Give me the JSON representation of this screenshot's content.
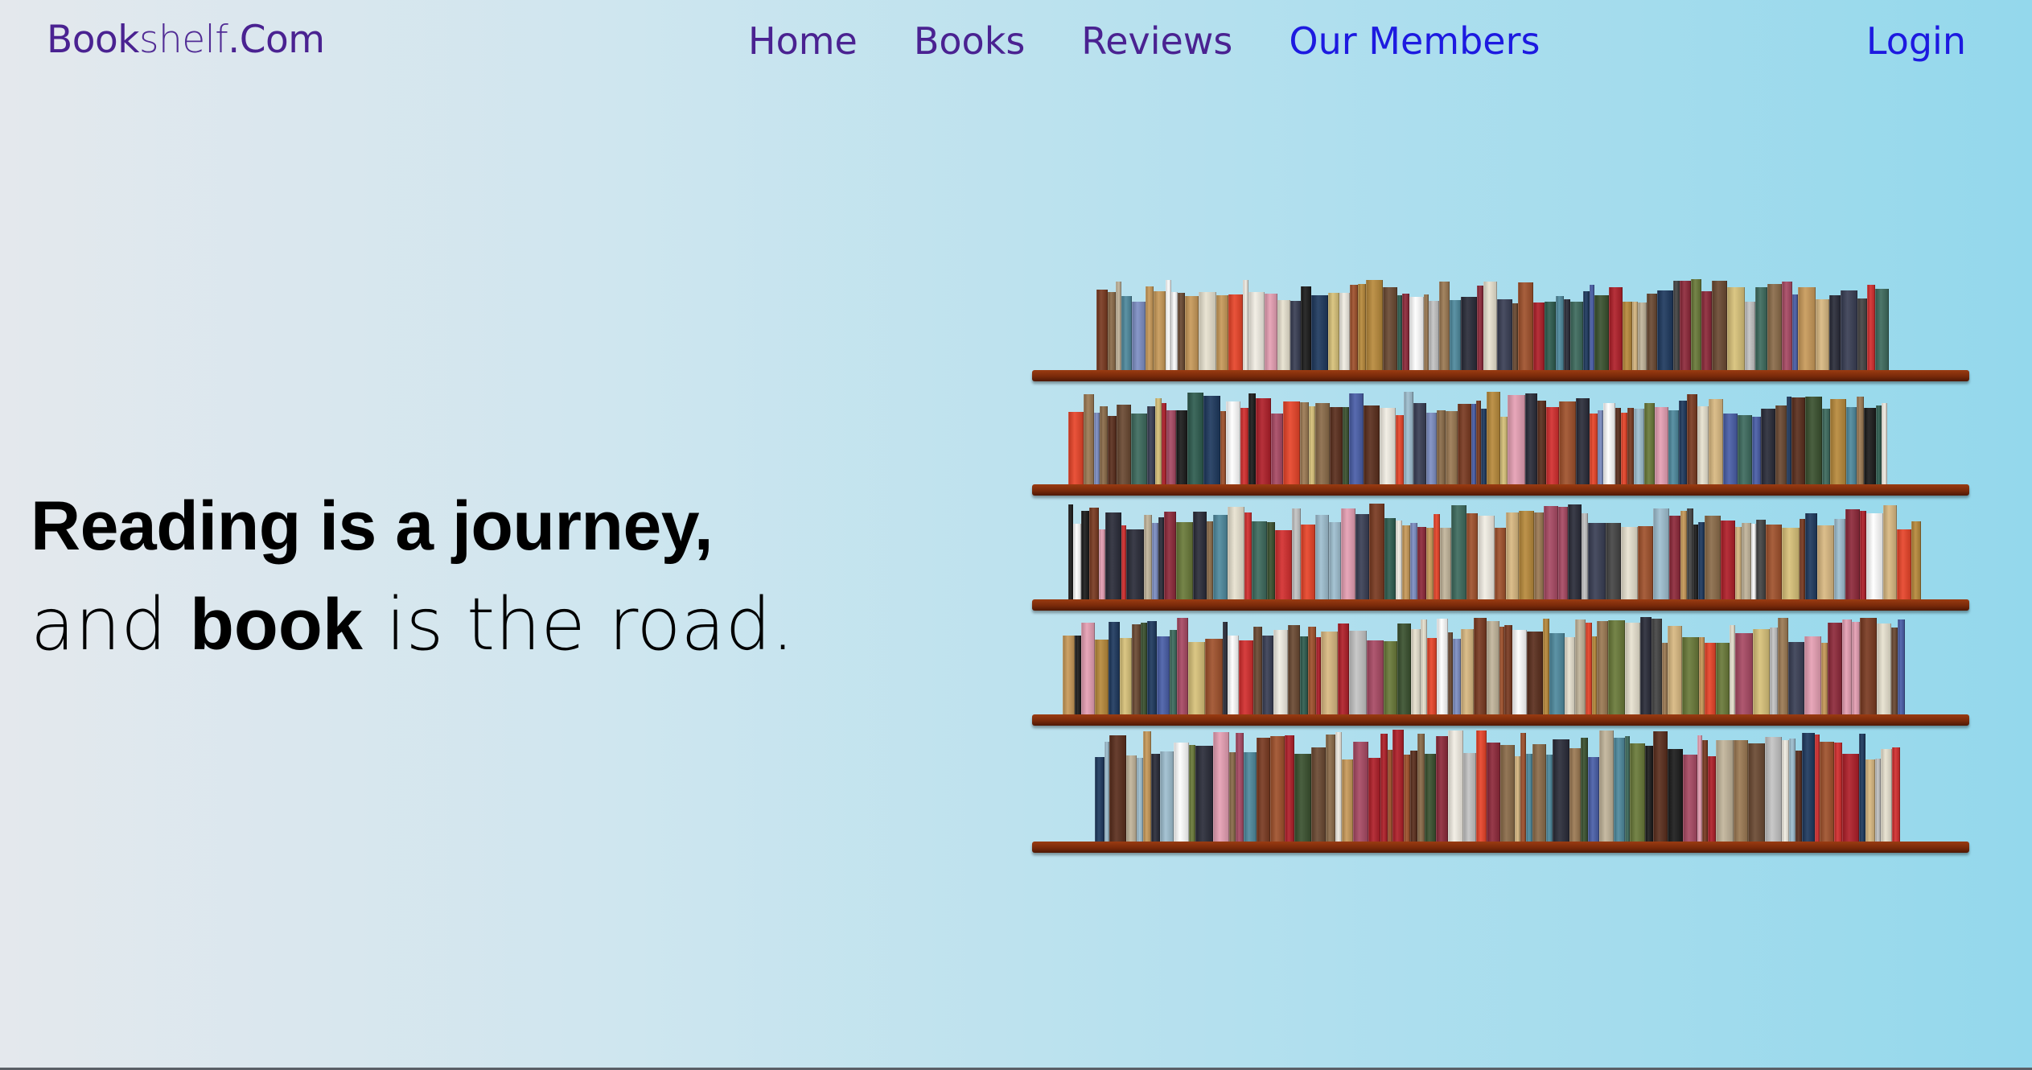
{
  "navbar": {
    "logo_part1": "Book",
    "logo_part2": "shelf",
    "logo_part3": ".Com",
    "links": [
      "Home",
      "Books",
      "Reviews",
      "Our Members"
    ],
    "active_link": "Our Members",
    "login_label": "Login"
  },
  "hero": {
    "line1": "Reading is a journey,",
    "line2_part1": "and ",
    "line2_part2": "book",
    "line2_part3": " is the road."
  },
  "colors": {
    "brand": "#4a2291",
    "link_active": "#1d1ae0",
    "shelf_wood": "#7a2a0a"
  },
  "image": {
    "semantic": "bookshelf-illustration"
  }
}
